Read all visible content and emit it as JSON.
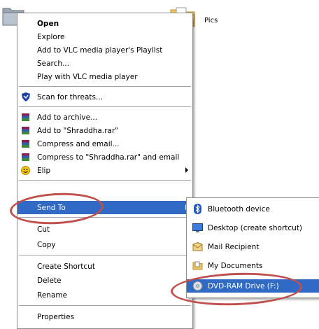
{
  "desktop": {
    "folder_label": "Pics"
  },
  "context_menu": {
    "items": [
      {
        "label": "Open",
        "bold": true
      },
      {
        "label": "Explore"
      },
      {
        "label": "Add to VLC media player's Playlist"
      },
      {
        "label": "Search..."
      },
      {
        "label": "Play with VLC media player"
      },
      {
        "label": "Scan for threats..."
      },
      {
        "label": "Add to archive..."
      },
      {
        "label": "Add to \"Shraddha.rar\""
      },
      {
        "label": "Compress and email..."
      },
      {
        "label": "Compress to \"Shraddha.rar\" and email"
      },
      {
        "label": "Elip"
      },
      {
        "label": "Send To"
      },
      {
        "label": "Cut"
      },
      {
        "label": "Copy"
      },
      {
        "label": "Create Shortcut"
      },
      {
        "label": "Delete"
      },
      {
        "label": "Rename"
      },
      {
        "label": "Properties"
      }
    ]
  },
  "send_to_menu": {
    "items": [
      {
        "label": "Bluetooth device"
      },
      {
        "label": "Desktop (create shortcut)"
      },
      {
        "label": "Mail Recipient"
      },
      {
        "label": "My Documents"
      },
      {
        "label": "DVD-RAM Drive (F:)"
      }
    ]
  },
  "colors": {
    "highlight": "#316ac5",
    "annotation_circle": "#c0504d"
  }
}
